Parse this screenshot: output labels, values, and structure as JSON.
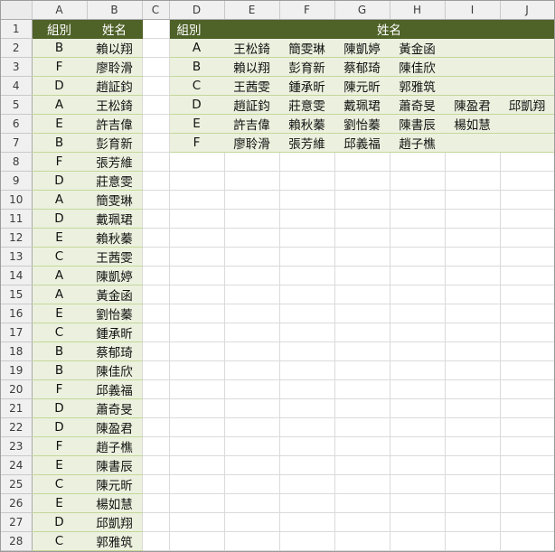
{
  "columns": [
    "A",
    "B",
    "C",
    "D",
    "E",
    "F",
    "G",
    "H",
    "I",
    "J"
  ],
  "source_list": {
    "header": [
      "組別",
      "姓名"
    ],
    "rows": [
      [
        "B",
        "賴以翔"
      ],
      [
        "F",
        "廖聆滑"
      ],
      [
        "D",
        "趙証鈞"
      ],
      [
        "A",
        "王松錡"
      ],
      [
        "E",
        "許吉偉"
      ],
      [
        "B",
        "彭育新"
      ],
      [
        "F",
        "張芳維"
      ],
      [
        "D",
        "莊意雯"
      ],
      [
        "A",
        "簡雯琳"
      ],
      [
        "D",
        "戴珮珺"
      ],
      [
        "E",
        "賴秋蓁"
      ],
      [
        "C",
        "王茜雯"
      ],
      [
        "A",
        "陳凱婷"
      ],
      [
        "A",
        "黃金函"
      ],
      [
        "E",
        "劉怡蓁"
      ],
      [
        "C",
        "鍾承昕"
      ],
      [
        "B",
        "蔡郁琦"
      ],
      [
        "B",
        "陳佳欣"
      ],
      [
        "F",
        "邱義福"
      ],
      [
        "D",
        "蕭奇旻"
      ],
      [
        "D",
        "陳盈君"
      ],
      [
        "F",
        "趙子樵"
      ],
      [
        "E",
        "陳書辰"
      ],
      [
        "C",
        "陳元昕"
      ],
      [
        "E",
        "楊如慧"
      ],
      [
        "D",
        "邱凱翔"
      ],
      [
        "C",
        "郭雅筑"
      ]
    ]
  },
  "grouped_table": {
    "group_header": "組別",
    "names_header": "姓名",
    "rows": [
      {
        "group": "A",
        "names": [
          "王松錡",
          "簡雯琳",
          "陳凱婷",
          "黃金函",
          "",
          "",
          ""
        ]
      },
      {
        "group": "B",
        "names": [
          "賴以翔",
          "彭育新",
          "蔡郁琦",
          "陳佳欣",
          "",
          "",
          ""
        ]
      },
      {
        "group": "C",
        "names": [
          "王茜雯",
          "鍾承昕",
          "陳元昕",
          "郭雅筑",
          "",
          "",
          ""
        ]
      },
      {
        "group": "D",
        "names": [
          "趙証鈞",
          "莊意雯",
          "戴珮珺",
          "蕭奇旻",
          "陳盈君",
          "邱凱翔",
          ""
        ]
      },
      {
        "group": "E",
        "names": [
          "許吉偉",
          "賴秋蓁",
          "劉怡蓁",
          "陳書辰",
          "楊如慧",
          "",
          ""
        ]
      },
      {
        "group": "F",
        "names": [
          "廖聆滑",
          "張芳維",
          "邱義福",
          "趙子樵",
          "",
          "",
          ""
        ]
      }
    ]
  },
  "colors": {
    "header_fill": "#4f6228",
    "band_fill": "#ebf1de"
  }
}
